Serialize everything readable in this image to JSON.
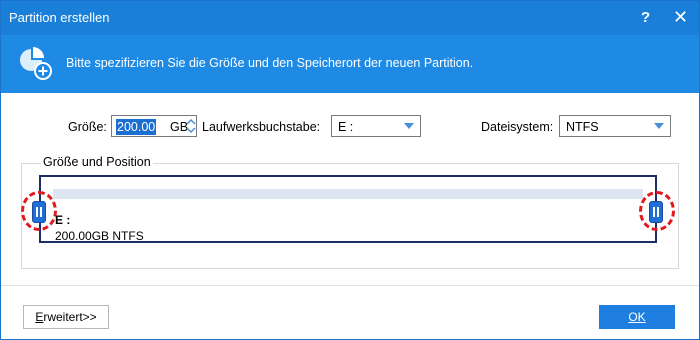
{
  "window": {
    "title": "Partition erstellen",
    "help_label": "?",
    "close_label": "✕"
  },
  "banner": {
    "text": "Bitte spezifizieren Sie die Größe und den Speicherort der neuen Partition.",
    "icon": "pie-chart-add-icon"
  },
  "form": {
    "size_label": "Größe:",
    "size_value": "200.00",
    "size_unit": "GB",
    "drive_letter_label": "Laufwerksbuchstabe:",
    "drive_letter_value": "E :",
    "filesystem_label": "Dateisystem:",
    "filesystem_value": "NTFS"
  },
  "position_group": {
    "title": "Größe und Position",
    "partition_letter": "E :",
    "partition_info": "200.00GB NTFS"
  },
  "buttons": {
    "advanced_first": "E",
    "advanced_rest": "rweitert>>",
    "ok": "OK"
  },
  "colors": {
    "titlebar": "#1a7fd8",
    "banner": "#1e8ae4",
    "handle": "#1f6fd6",
    "highlight_ring": "#e0191e",
    "ok_button": "#1f7fe0"
  }
}
